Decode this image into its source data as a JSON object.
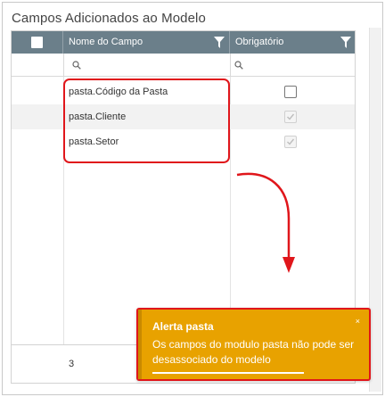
{
  "panel": {
    "title": "Campos Adicionados ao Modelo"
  },
  "grid": {
    "columns": [
      {
        "label": "Nome do Campo"
      },
      {
        "label": "Obrigatório"
      }
    ],
    "rows": [
      {
        "field": "pasta.Código da Pasta",
        "required": false,
        "required_disabled": false
      },
      {
        "field": "pasta.Cliente",
        "required": true,
        "required_disabled": true
      },
      {
        "field": "pasta.Setor",
        "required": true,
        "required_disabled": true
      }
    ],
    "footer_count": "3"
  },
  "toast": {
    "title": "Alerta pasta",
    "message": "Os campos do modulo pasta não pode ser desassociado do modelo",
    "close": "×"
  },
  "colors": {
    "header_bg": "#6b7f8a",
    "toast_bg": "#e8a200",
    "highlight": "#e0161b"
  },
  "icons": [
    "filter-icon",
    "search-icon",
    "checkbox-icon",
    "close-icon",
    "arrow-icon"
  ]
}
